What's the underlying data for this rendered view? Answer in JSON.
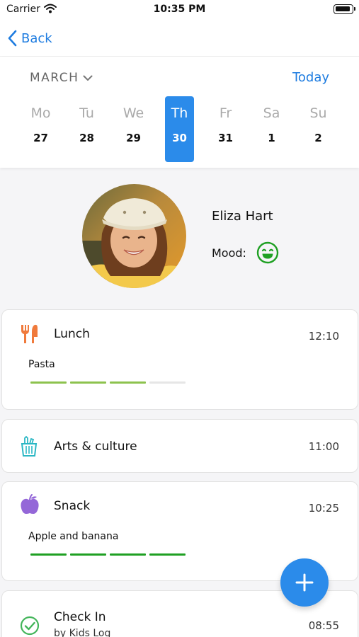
{
  "status_bar": {
    "carrier": "Carrier",
    "time": "10:35 PM"
  },
  "nav": {
    "back_label": "Back"
  },
  "calendar": {
    "month": "MARCH",
    "today_label": "Today",
    "days": [
      {
        "name": "Mo",
        "date": "27",
        "selected": false
      },
      {
        "name": "Tu",
        "date": "28",
        "selected": false
      },
      {
        "name": "We",
        "date": "29",
        "selected": false
      },
      {
        "name": "Th",
        "date": "30",
        "selected": true
      },
      {
        "name": "Fr",
        "date": "31",
        "selected": false
      },
      {
        "name": "Sa",
        "date": "1",
        "selected": false
      },
      {
        "name": "Su",
        "date": "2",
        "selected": false
      }
    ]
  },
  "child": {
    "name": "Eliza Hart",
    "mood_label": "Mood:",
    "mood_icon": "happy-face-icon"
  },
  "entries": [
    {
      "title": "Lunch",
      "time": "12:10",
      "description": "Pasta",
      "icon": "fork-knife-icon",
      "icon_color": "#f07a3c",
      "rating": 3,
      "rating_max": 4,
      "rating_color": "#8dc24e"
    },
    {
      "title": "Arts & culture",
      "time": "11:00",
      "icon": "art-supplies-icon",
      "icon_color": "#2bb7c4"
    },
    {
      "title": "Snack",
      "time": "10:25",
      "description": "Apple and banana",
      "icon": "apple-icon",
      "icon_color": "#9467d8",
      "rating": 4,
      "rating_max": 4,
      "rating_color": "#1fa023"
    },
    {
      "title": "Check In",
      "time": "08:55",
      "subtitle": "by Kids Log",
      "icon": "check-circle-icon",
      "icon_color": "#43b55a"
    }
  ],
  "colors": {
    "accent": "#2b8bea",
    "link": "#1e7ce0",
    "mood": "#1fa023",
    "empty_segment": "#e6e6e6"
  }
}
